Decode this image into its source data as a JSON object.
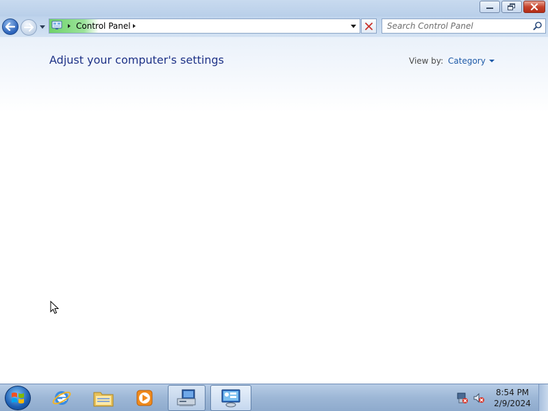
{
  "window": {
    "caption_buttons": {
      "minimize": "minimize-icon",
      "restore": "restore-icon",
      "close": "close-icon"
    }
  },
  "navigation": {
    "back_icon": "back-arrow-icon",
    "forward_icon": "forward-arrow-icon",
    "recent_pages_icon": "chevron-down-icon"
  },
  "address_bar": {
    "location_icon": "control-panel-icon",
    "breadcrumb": [
      "Control Panel"
    ],
    "dropdown_icon": "chevron-down-icon",
    "refresh_icon": "stop-x-icon"
  },
  "search": {
    "placeholder": "Search Control Panel",
    "value": "",
    "icon": "search-icon"
  },
  "content": {
    "title": "Adjust your computer's settings",
    "view_by_label": "View by:",
    "view_by_value": "Category"
  },
  "taskbar": {
    "start_icon": "windows-start-orb-icon",
    "apps": [
      {
        "name": "Internet Explorer",
        "icon": "internet-explorer-icon",
        "active": false
      },
      {
        "name": "Windows Explorer",
        "icon": "folder-icon",
        "active": false
      },
      {
        "name": "Windows Media Player",
        "icon": "media-player-icon",
        "active": false
      },
      {
        "name": "Network Computer",
        "icon": "network-computer-icon",
        "active": true
      },
      {
        "name": "Control Panel",
        "icon": "control-panel-icon",
        "active": true
      }
    ],
    "tray_icons": [
      "network-disconnected-icon",
      "volume-muted-icon"
    ],
    "time": "8:54 PM",
    "date": "2/9/2024"
  },
  "colors": {
    "title_text": "#1e3287",
    "link_text": "#1e5aa8",
    "address_highlight": "#6fd26a",
    "close_button": "#c6442d"
  }
}
